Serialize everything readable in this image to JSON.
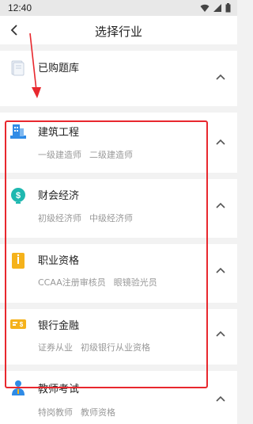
{
  "status_bar": {
    "time": "12:40"
  },
  "header": {
    "title": "选择行业"
  },
  "purchased": {
    "label": "已购题库"
  },
  "categories": [
    {
      "title": "建筑工程",
      "subs": [
        "一级建造师",
        "二级建造师"
      ]
    },
    {
      "title": "财会经济",
      "subs": [
        "初级经济师",
        "中级经济师"
      ]
    },
    {
      "title": "职业资格",
      "subs": [
        "CCAA注册审核员",
        "眼镜验光员"
      ]
    },
    {
      "title": "银行金融",
      "subs": [
        "证券从业",
        "初级银行从业资格"
      ]
    },
    {
      "title": "教师考试",
      "subs": [
        "特岗教师",
        "教师资格"
      ]
    }
  ],
  "icons": {
    "back": "chevron-left-icon",
    "book": "book-icon",
    "building": "building-icon",
    "finance": "dollar-coin-icon",
    "career": "badge-icon",
    "bank": "banknote-icon",
    "teacher": "teacher-icon",
    "expand": "chevron-up-icon"
  },
  "colors": {
    "highlight": "#e8282e",
    "blue": "#2f8be6",
    "teal": "#1fb8b0",
    "gold": "#f5b21b"
  }
}
